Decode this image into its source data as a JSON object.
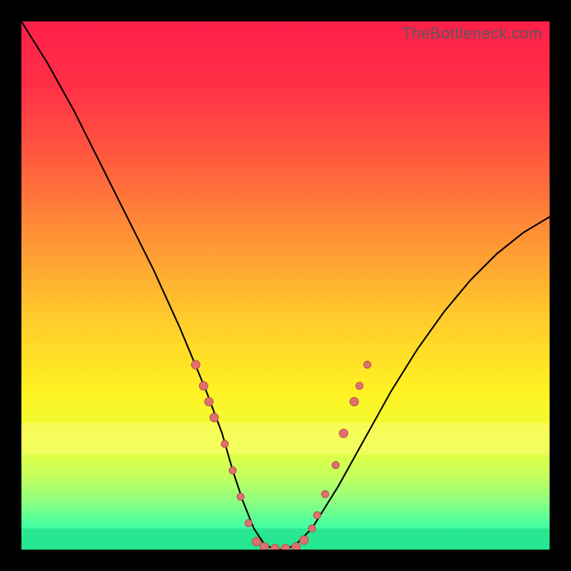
{
  "watermark": "TheBottleneck.com",
  "colors": {
    "bg": "#000000",
    "gradient_stops": [
      {
        "offset": 0.0,
        "color": "#ff1f4a"
      },
      {
        "offset": 0.12,
        "color": "#ff2f46"
      },
      {
        "offset": 0.25,
        "color": "#ff573f"
      },
      {
        "offset": 0.4,
        "color": "#ff8f36"
      },
      {
        "offset": 0.55,
        "color": "#ffc72c"
      },
      {
        "offset": 0.7,
        "color": "#fff222"
      },
      {
        "offset": 0.8,
        "color": "#eaff3a"
      },
      {
        "offset": 0.86,
        "color": "#c6ff5e"
      },
      {
        "offset": 0.91,
        "color": "#8cff80"
      },
      {
        "offset": 0.95,
        "color": "#4cffa0"
      },
      {
        "offset": 1.0,
        "color": "#1bffab"
      }
    ],
    "band_yellow": "#fdfc76",
    "band_green": "#27e48e",
    "curve": "#000000",
    "dot_fill": "#e07070",
    "dot_stroke": "#b44a4a"
  },
  "chart_data": {
    "type": "line",
    "title": "",
    "xlabel": "",
    "ylabel": "",
    "xlim": [
      0,
      100
    ],
    "ylim": [
      0,
      100
    ],
    "series": [
      {
        "name": "bottleneck-curve",
        "x": [
          0,
          5,
          10,
          15,
          20,
          25,
          30,
          35,
          38,
          40,
          42,
          44,
          46,
          48,
          50,
          52,
          55,
          60,
          65,
          70,
          75,
          80,
          85,
          90,
          95,
          100
        ],
        "y": [
          100,
          92,
          83,
          73,
          63,
          53,
          42,
          30,
          22,
          15,
          9,
          4,
          1,
          0,
          0,
          1,
          4,
          12,
          21,
          30,
          38,
          45,
          51,
          56,
          60,
          63
        ]
      }
    ],
    "scatter": {
      "name": "sample-dots",
      "points": [
        {
          "x": 33.0,
          "y": 35.0,
          "r": 6
        },
        {
          "x": 34.5,
          "y": 31.0,
          "r": 6
        },
        {
          "x": 35.5,
          "y": 28.0,
          "r": 6
        },
        {
          "x": 36.5,
          "y": 25.0,
          "r": 6
        },
        {
          "x": 38.5,
          "y": 20.0,
          "r": 5
        },
        {
          "x": 40.0,
          "y": 15.0,
          "r": 5
        },
        {
          "x": 41.5,
          "y": 10.0,
          "r": 5
        },
        {
          "x": 43.0,
          "y": 5.0,
          "r": 5
        },
        {
          "x": 44.5,
          "y": 1.5,
          "r": 6
        },
        {
          "x": 46.0,
          "y": 0.5,
          "r": 6
        },
        {
          "x": 48.0,
          "y": 0.2,
          "r": 6
        },
        {
          "x": 50.0,
          "y": 0.2,
          "r": 6
        },
        {
          "x": 52.0,
          "y": 0.5,
          "r": 6
        },
        {
          "x": 53.5,
          "y": 1.8,
          "r": 6
        },
        {
          "x": 55.0,
          "y": 4.0,
          "r": 5
        },
        {
          "x": 56.0,
          "y": 6.5,
          "r": 5
        },
        {
          "x": 57.5,
          "y": 10.5,
          "r": 5
        },
        {
          "x": 59.5,
          "y": 16.0,
          "r": 5
        },
        {
          "x": 61.0,
          "y": 22.0,
          "r": 6
        },
        {
          "x": 63.0,
          "y": 28.0,
          "r": 6
        },
        {
          "x": 64.0,
          "y": 31.0,
          "r": 5
        },
        {
          "x": 65.5,
          "y": 35.0,
          "r": 5
        }
      ]
    },
    "bands": [
      {
        "name": "yellow-band",
        "y0": 18,
        "y1": 24,
        "color_key": "band_yellow",
        "alpha": 0.55
      },
      {
        "name": "green-band",
        "y0": 0,
        "y1": 4,
        "color_key": "band_green",
        "alpha": 0.9
      }
    ]
  }
}
